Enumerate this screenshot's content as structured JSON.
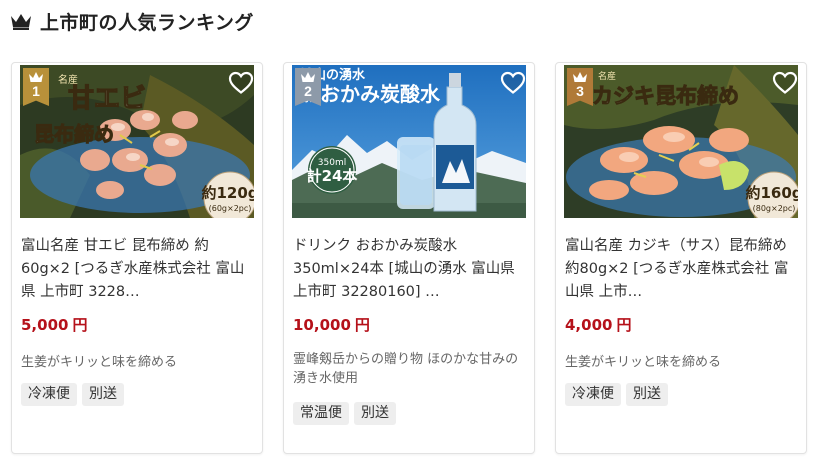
{
  "section": {
    "title": "上市町の人気ランキング"
  },
  "products": [
    {
      "rank": "1",
      "name": "富山名産 甘エビ 昆布締め 約60g×2 [つるぎ水産株式会社 富山県 上市町 3228…",
      "price": "5,000",
      "currency": "円",
      "description": "生姜がキリッと味を締める",
      "tags": [
        "冷凍便",
        "別送"
      ],
      "image_text": {
        "title": "甘エビ",
        "subtitle": "昆布締め",
        "weight_main": "約120g",
        "weight_sub": "(60g×2pc)",
        "corner": "名産"
      }
    },
    {
      "rank": "2",
      "name": "ドリンク おおかみ炭酸水 350ml×24本 [城山の湧水 富山県 上市町 32280160] …",
      "price": "10,000",
      "currency": "円",
      "description": "霊峰剱岳からの贈り物 ほのかな甘みの湧き水使用",
      "tags": [
        "常温便",
        "別送"
      ],
      "image_text": {
        "line1": "城山の湧水",
        "line2": "おおかみ炭酸水",
        "badge_top": "350ml",
        "badge_bottom": "計24本"
      }
    },
    {
      "rank": "3",
      "name": "富山名産 カジキ（サス）昆布締め 約80g×2 [つるぎ水産株式会社 富山県 上市…",
      "price": "4,000",
      "currency": "円",
      "description": "生姜がキリッと味を締める",
      "tags": [
        "冷凍便",
        "別送"
      ],
      "image_text": {
        "title": "カジキ昆布締め",
        "weight_main": "約160g",
        "weight_sub": "(80g×2pc)",
        "corner": "名産"
      }
    }
  ],
  "colors": {
    "price": "#b5111a",
    "gold": "#b8913a",
    "silver": "#8d9aa9",
    "bronze": "#b07a38"
  },
  "icons": {
    "header": "crown-icon",
    "favorite": "heart-outline-icon"
  }
}
